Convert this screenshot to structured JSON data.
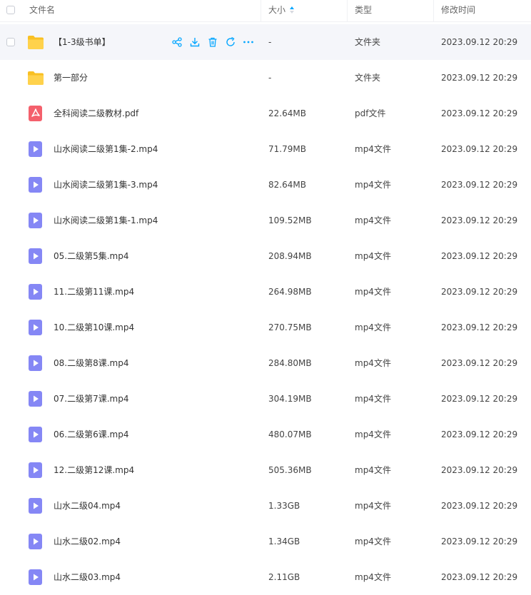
{
  "header": {
    "col_name": "文件名",
    "col_size": "大小",
    "col_type": "类型",
    "col_time": "修改时间"
  },
  "accent_color": "#06a7ff",
  "rows": [
    {
      "name": "【1-3级书单】",
      "size": "-",
      "type": "文件夹",
      "time": "2023.09.12 20:29",
      "icon": "folder-icon"
    },
    {
      "name": "第一部分",
      "size": "-",
      "type": "文件夹",
      "time": "2023.09.12 20:29",
      "icon": "folder-icon"
    },
    {
      "name": "全科阅读二级教材.pdf",
      "size": "22.64MB",
      "type": "pdf文件",
      "time": "2023.09.12 20:29",
      "icon": "pdf-icon"
    },
    {
      "name": "山水阅读二级第1集-2.mp4",
      "size": "71.79MB",
      "type": "mp4文件",
      "time": "2023.09.12 20:29",
      "icon": "video-icon"
    },
    {
      "name": "山水阅读二级第1集-3.mp4",
      "size": "82.64MB",
      "type": "mp4文件",
      "time": "2023.09.12 20:29",
      "icon": "video-icon"
    },
    {
      "name": "山水阅读二级第1集-1.mp4",
      "size": "109.52MB",
      "type": "mp4文件",
      "time": "2023.09.12 20:29",
      "icon": "video-icon"
    },
    {
      "name": "05.二级第5集.mp4",
      "size": "208.94MB",
      "type": "mp4文件",
      "time": "2023.09.12 20:29",
      "icon": "video-icon"
    },
    {
      "name": "11.二级第11课.mp4",
      "size": "264.98MB",
      "type": "mp4文件",
      "time": "2023.09.12 20:29",
      "icon": "video-icon"
    },
    {
      "name": "10.二级第10课.mp4",
      "size": "270.75MB",
      "type": "mp4文件",
      "time": "2023.09.12 20:29",
      "icon": "video-icon"
    },
    {
      "name": "08.二级第8课.mp4",
      "size": "284.80MB",
      "type": "mp4文件",
      "time": "2023.09.12 20:29",
      "icon": "video-icon"
    },
    {
      "name": "07.二级第7课.mp4",
      "size": "304.19MB",
      "type": "mp4文件",
      "time": "2023.09.12 20:29",
      "icon": "video-icon"
    },
    {
      "name": "06.二级第6课.mp4",
      "size": "480.07MB",
      "type": "mp4文件",
      "time": "2023.09.12 20:29",
      "icon": "video-icon"
    },
    {
      "name": "12.二级第12课.mp4",
      "size": "505.36MB",
      "type": "mp4文件",
      "time": "2023.09.12 20:29",
      "icon": "video-icon"
    },
    {
      "name": "山水二级04.mp4",
      "size": "1.33GB",
      "type": "mp4文件",
      "time": "2023.09.12 20:29",
      "icon": "video-icon"
    },
    {
      "name": "山水二级02.mp4",
      "size": "1.34GB",
      "type": "mp4文件",
      "time": "2023.09.12 20:29",
      "icon": "video-icon"
    },
    {
      "name": "山水二级03.mp4",
      "size": "2.11GB",
      "type": "mp4文件",
      "time": "2023.09.12 20:29",
      "icon": "video-icon"
    }
  ],
  "hover_actions": [
    "share-icon",
    "download-icon",
    "delete-icon",
    "refresh-icon",
    "more-icon"
  ]
}
